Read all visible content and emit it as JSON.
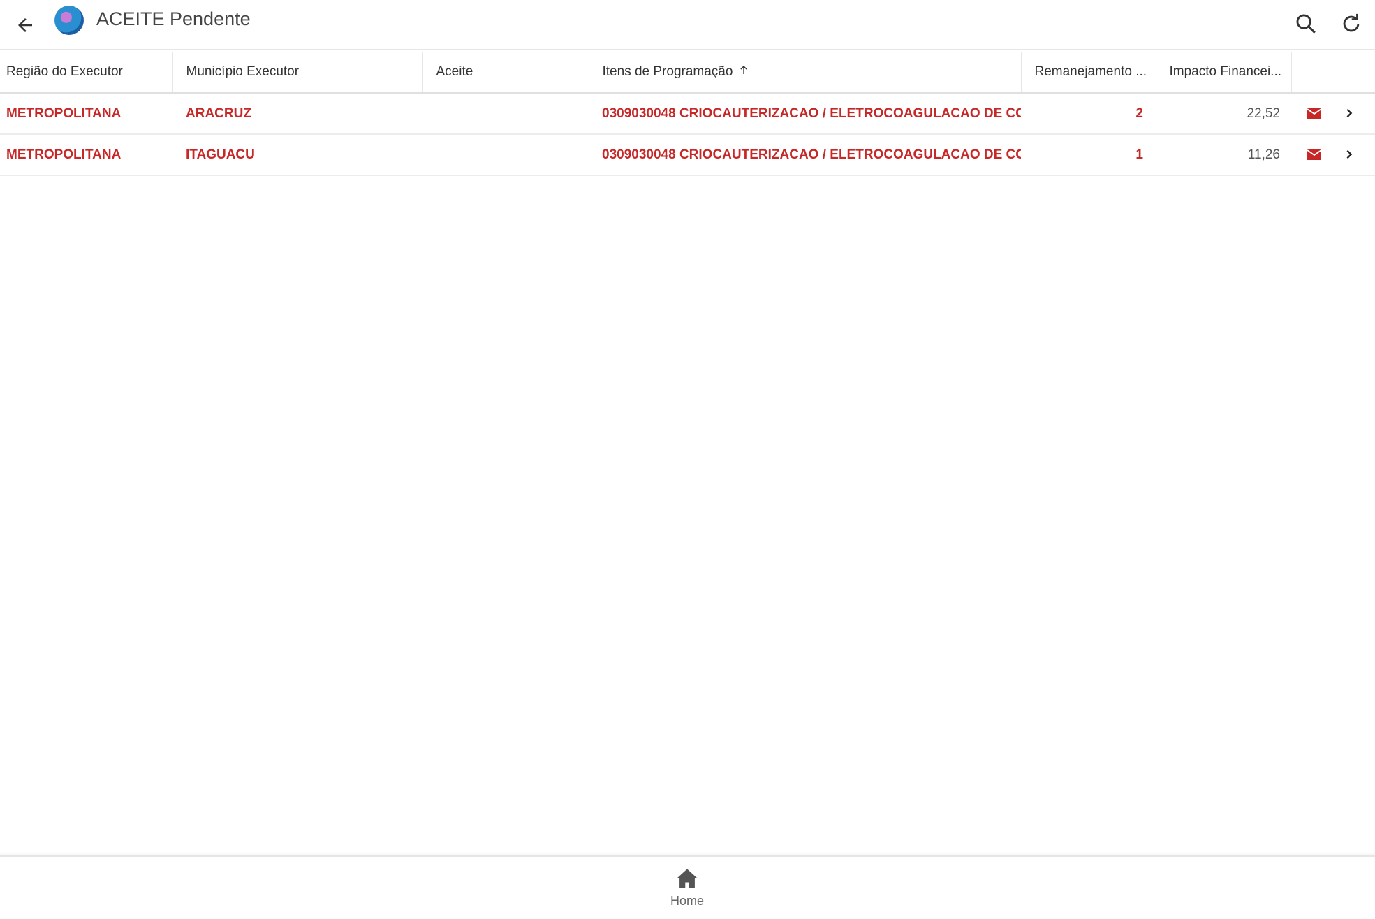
{
  "header": {
    "title": "ACEITE Pendente"
  },
  "table": {
    "columns": [
      "Região do Executor",
      "Município Executor",
      "Aceite",
      "Itens de Programação",
      "Remanejamento ...",
      "Impacto Financei..."
    ],
    "rows": [
      {
        "regiao": "METROPOLITANA",
        "municipio": "ARACRUZ",
        "aceite": "",
        "itens": "0309030048 CRIOCAUTERIZACAO / ELETROCOAGULACAO DE CC",
        "remanejamento": "2",
        "impacto": "22,52"
      },
      {
        "regiao": "METROPOLITANA",
        "municipio": "ITAGUACU",
        "aceite": "",
        "itens": "0309030048 CRIOCAUTERIZACAO / ELETROCOAGULACAO DE CC",
        "remanejamento": "1",
        "impacto": "11,26"
      }
    ]
  },
  "nav": {
    "home_label": "Home"
  },
  "colors": {
    "accent": "#c62828"
  }
}
